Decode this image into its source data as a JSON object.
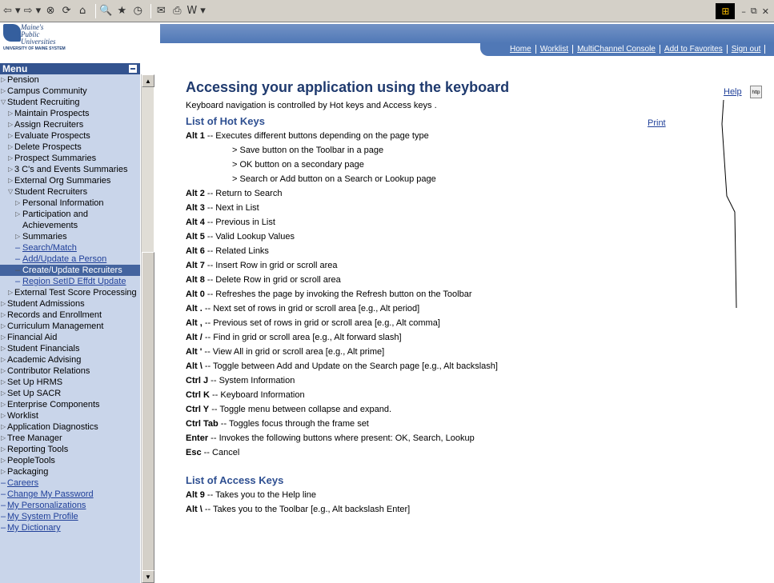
{
  "toolbar": {
    "buttons": [
      "back-icon",
      "forward-icon",
      "stop-icon",
      "refresh-icon",
      "home-icon",
      "search-icon",
      "favorites-icon",
      "history-icon",
      "mail-icon",
      "print-icon",
      "edit-icon"
    ],
    "glyphs": [
      "⇦ ▾",
      "⇨ ▾",
      "⊗",
      "⟳",
      "⌂",
      "🔍",
      "★",
      "◷",
      "✉",
      "⎙",
      "W ▾"
    ],
    "window_controls": [
      "–",
      "⧉",
      "✕"
    ]
  },
  "header": {
    "logo_line1": "Maine's",
    "logo_line2": "Public",
    "logo_line3": "Universities",
    "logo_sub": "UNIVERSITY OF MAINE SYSTEM",
    "nav_links": [
      "Home",
      "Worklist",
      "MultiChannel Console",
      "Add to Favorites",
      "Sign out"
    ]
  },
  "menu": {
    "title": "Menu",
    "items": [
      {
        "label": "Pension",
        "level": 1,
        "arrow": "▷"
      },
      {
        "label": "Campus Community",
        "level": 1,
        "arrow": "▷"
      },
      {
        "label": "Student Recruiting",
        "level": 1,
        "arrow": "▽"
      },
      {
        "label": "Maintain Prospects",
        "level": 2,
        "arrow": "▷"
      },
      {
        "label": "Assign Recruiters",
        "level": 2,
        "arrow": "▷"
      },
      {
        "label": "Evaluate Prospects",
        "level": 2,
        "arrow": "▷"
      },
      {
        "label": "Delete Prospects",
        "level": 2,
        "arrow": "▷"
      },
      {
        "label": "Prospect Summaries",
        "level": 2,
        "arrow": "▷"
      },
      {
        "label": "3 C's and Events Summaries",
        "level": 2,
        "arrow": "▷"
      },
      {
        "label": "External Org Summaries",
        "level": 2,
        "arrow": "▷"
      },
      {
        "label": "Student Recruiters",
        "level": 2,
        "arrow": "▽"
      },
      {
        "label": "Personal Information",
        "level": 3,
        "arrow": "▷"
      },
      {
        "label": "Participation and Achievements",
        "level": 3,
        "arrow": "▷"
      },
      {
        "label": "Summaries",
        "level": 3,
        "arrow": "▷"
      },
      {
        "label": "Search/Match",
        "level": 3,
        "arrow": "–",
        "link": true
      },
      {
        "label": "Add/Update a Person",
        "level": 3,
        "arrow": "–",
        "link": true
      },
      {
        "label": "Create/Update Recruiters",
        "level": 3,
        "arrow": "–",
        "active": true
      },
      {
        "label": "Region SetID Effdt Update",
        "level": 3,
        "arrow": "–",
        "link": true
      },
      {
        "label": "External Test Score Processing",
        "level": 2,
        "arrow": "▷"
      },
      {
        "label": "Student Admissions",
        "level": 1,
        "arrow": "▷"
      },
      {
        "label": "Records and Enrollment",
        "level": 1,
        "arrow": "▷"
      },
      {
        "label": "Curriculum Management",
        "level": 1,
        "arrow": "▷"
      },
      {
        "label": "Financial Aid",
        "level": 1,
        "arrow": "▷"
      },
      {
        "label": "Student Financials",
        "level": 1,
        "arrow": "▷"
      },
      {
        "label": "Academic Advising",
        "level": 1,
        "arrow": "▷"
      },
      {
        "label": "Contributor Relations",
        "level": 1,
        "arrow": "▷"
      },
      {
        "label": "Set Up HRMS",
        "level": 1,
        "arrow": "▷"
      },
      {
        "label": "Set Up SACR",
        "level": 1,
        "arrow": "▷"
      },
      {
        "label": "Enterprise Components",
        "level": 1,
        "arrow": "▷"
      },
      {
        "label": "Worklist",
        "level": 1,
        "arrow": "▷"
      },
      {
        "label": "Application Diagnostics",
        "level": 1,
        "arrow": "▷"
      },
      {
        "label": "Tree Manager",
        "level": 1,
        "arrow": "▷"
      },
      {
        "label": "Reporting Tools",
        "level": 1,
        "arrow": "▷"
      },
      {
        "label": "PeopleTools",
        "level": 1,
        "arrow": "▷"
      },
      {
        "label": "Packaging",
        "level": 1,
        "arrow": "▷"
      },
      {
        "label": "Careers",
        "level": 1,
        "arrow": "–",
        "link": true
      },
      {
        "label": "Change My Password",
        "level": 1,
        "arrow": "–",
        "link": true
      },
      {
        "label": "My Personalizations",
        "level": 1,
        "arrow": "–",
        "link": true
      },
      {
        "label": "My System Profile",
        "level": 1,
        "arrow": "–",
        "link": true
      },
      {
        "label": "My Dictionary",
        "level": 1,
        "arrow": "–",
        "link": true
      }
    ]
  },
  "content": {
    "title": "Accessing your application using the keyboard",
    "intro": "Keyboard navigation is controlled by Hot keys and Access keys .",
    "print_label": "Print",
    "help_label": "Help",
    "help_icon_text": "http",
    "hot_keys_heading": "List of Hot Keys",
    "hot_key_1": {
      "key": "Alt 1",
      "desc": " -- Executes different buttons depending on the page type"
    },
    "alt1_subitems": [
      "> Save button on the Toolbar in a page",
      "> OK button on a secondary page",
      "> Search or Add button on a Search or Lookup page"
    ],
    "hot_keys": [
      {
        "key": "Alt 2",
        "desc": " -- Return to Search"
      },
      {
        "key": "Alt 3",
        "desc": " -- Next in List"
      },
      {
        "key": "Alt 4",
        "desc": " -- Previous in List"
      },
      {
        "key": "Alt 5",
        "desc": " -- Valid Lookup Values"
      },
      {
        "key": "Alt 6",
        "desc": " -- Related Links"
      },
      {
        "key": "Alt 7",
        "desc": " -- Insert Row in grid or scroll area"
      },
      {
        "key": "Alt 8",
        "desc": " -- Delete Row in grid or scroll area"
      },
      {
        "key": "Alt 0",
        "desc": " -- Refreshes the page by invoking the Refresh button on the Toolbar"
      },
      {
        "key": "Alt .",
        "desc": " -- Next set of rows in grid or scroll area [e.g., Alt period]"
      },
      {
        "key": "Alt ,",
        "desc": " -- Previous set of rows in grid or scroll area [e.g., Alt comma]"
      },
      {
        "key": "Alt /",
        "desc": " -- Find in grid or scroll area [e.g., Alt forward slash]"
      },
      {
        "key": "Alt '",
        "desc": " -- View All in grid or scroll area [e.g., Alt prime]"
      },
      {
        "key": "Alt \\",
        "desc": " -- Toggle between Add and Update on the Search page [e.g., Alt backslash]"
      },
      {
        "key": "Ctrl J",
        "desc": " -- System Information"
      },
      {
        "key": "Ctrl K",
        "desc": " -- Keyboard Information"
      },
      {
        "key": "Ctrl Y",
        "desc": " -- Toggle menu between collapse and expand."
      },
      {
        "key": "Ctrl Tab",
        "desc": " -- Toggles focus through the frame set"
      },
      {
        "key": "Enter",
        "desc": " -- Invokes the following buttons where present: OK, Search, Lookup"
      },
      {
        "key": "Esc",
        "desc": " -- Cancel"
      }
    ],
    "access_keys_heading": "List of Access Keys",
    "access_keys": [
      {
        "key": "Alt 9",
        "desc": " -- Takes you to the Help line"
      },
      {
        "key": "Alt \\",
        "desc": " -- Takes you to the Toolbar [e.g., Alt backslash Enter]"
      }
    ]
  }
}
